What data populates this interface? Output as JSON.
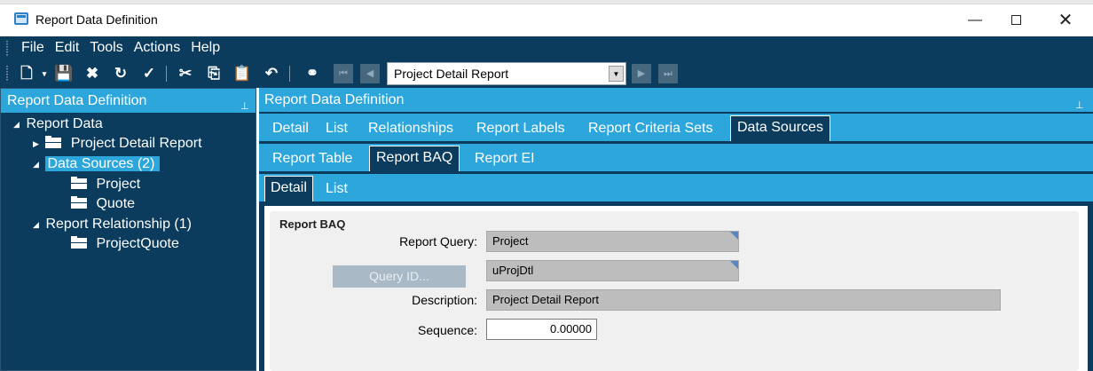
{
  "window": {
    "title": "Report Data Definition"
  },
  "menu": {
    "items": [
      "File",
      "Edit",
      "Tools",
      "Actions",
      "Help"
    ]
  },
  "toolbar": {
    "report_selector": {
      "value": "Project Detail Report"
    }
  },
  "tree_panel": {
    "header": "Report Data Definition",
    "nodes": [
      {
        "label": "Report Data"
      },
      {
        "label": "Project Detail Report"
      },
      {
        "label": "Data Sources (2)"
      },
      {
        "label": "Project"
      },
      {
        "label": "Quote"
      },
      {
        "label": "Report Relationship (1)"
      },
      {
        "label": "ProjectQuote"
      }
    ]
  },
  "main_panel": {
    "header": "Report Data Definition",
    "tabs": [
      "Detail",
      "List",
      "Relationships",
      "Report Labels",
      "Report Criteria Sets",
      "Data Sources"
    ],
    "subtabs": [
      "Report Table",
      "Report BAQ",
      "Report EI"
    ],
    "subsubtabs": [
      "Detail",
      "List"
    ],
    "group_title": "Report BAQ",
    "fields": {
      "report_query": {
        "label": "Report Query:",
        "value": "Project"
      },
      "query_id": {
        "button_label": "Query ID...",
        "value": "uProjDtl"
      },
      "description": {
        "label": "Description:",
        "value": "Project Detail Report"
      },
      "sequence": {
        "label": "Sequence:",
        "value": "0.00000"
      }
    }
  },
  "colors": {
    "dark_navy": "#0b3c5d",
    "accent_blue": "#2da6dc",
    "readonly_field": "#bdbdbd"
  }
}
